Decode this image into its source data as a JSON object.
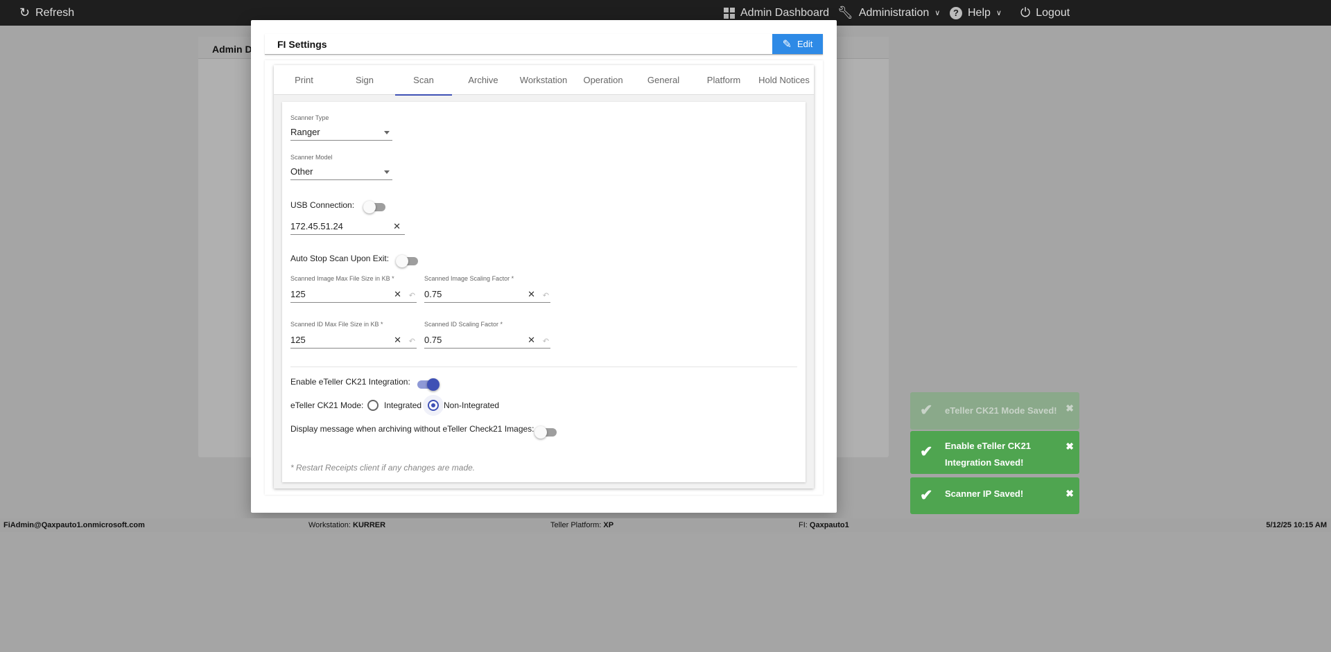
{
  "topbar": {
    "refresh": "Refresh",
    "admin_dashboard": "Admin Dashboard",
    "administration": "Administration",
    "help": "Help",
    "logout": "Logout"
  },
  "background": {
    "panel_title": "Admin D"
  },
  "modal": {
    "title": "FI Settings",
    "edit_label": "Edit",
    "tabs": [
      "Print",
      "Sign",
      "Scan",
      "Archive",
      "Workstation",
      "Operation",
      "General",
      "Platform",
      "Hold Notices"
    ],
    "active_tab": "Scan",
    "scan": {
      "scanner_type_label": "Scanner Type",
      "scanner_type": "Ranger",
      "scanner_model_label": "Scanner Model",
      "scanner_model": "Other",
      "usb_label": "USB Connection:",
      "usb_on": false,
      "ip": "172.45.51.24",
      "auto_stop_label": "Auto Stop Scan Upon Exit:",
      "auto_stop_on": false,
      "img_size_label": "Scanned Image Max File Size in KB *",
      "img_size": "125",
      "img_scale_label": "Scanned Image Scaling Factor *",
      "img_scale": "0.75",
      "id_size_label": "Scanned ID Max File Size in KB *",
      "id_size": "125",
      "id_scale_label": "Scanned ID Scaling Factor *",
      "id_scale": "0.75",
      "ck21_label": "Enable eTeller CK21 Integration:",
      "ck21_on": true,
      "mode_label": "eTeller CK21 Mode:",
      "mode_integrated": "Integrated",
      "mode_non": "Non-Integrated",
      "mode_selected": "Non-Integrated",
      "display_msg_label": "Display message when archiving without eTeller Check21 Images:",
      "display_msg_on": false,
      "note": "* Restart Receipts client if any changes are made."
    }
  },
  "toasts": [
    "eTeller CK21 Mode Saved!",
    "Enable eTeller CK21 Integration Saved!",
    "Scanner IP Saved!"
  ],
  "footer": {
    "user": "FiAdmin@Qaxpauto1.onmicrosoft.com",
    "workstation_label": "Workstation:",
    "workstation": "KURRER",
    "platform_label": "Teller Platform:",
    "platform": "XP",
    "fi_label": "FI:",
    "fi": "Qaxpauto1",
    "datetime": "5/12/25 10:15 AM"
  },
  "colors": {
    "accent": "#3f51b5",
    "edit": "#2e8ae6",
    "toast": "#4fa550",
    "topbar": "#1e1e1e"
  }
}
